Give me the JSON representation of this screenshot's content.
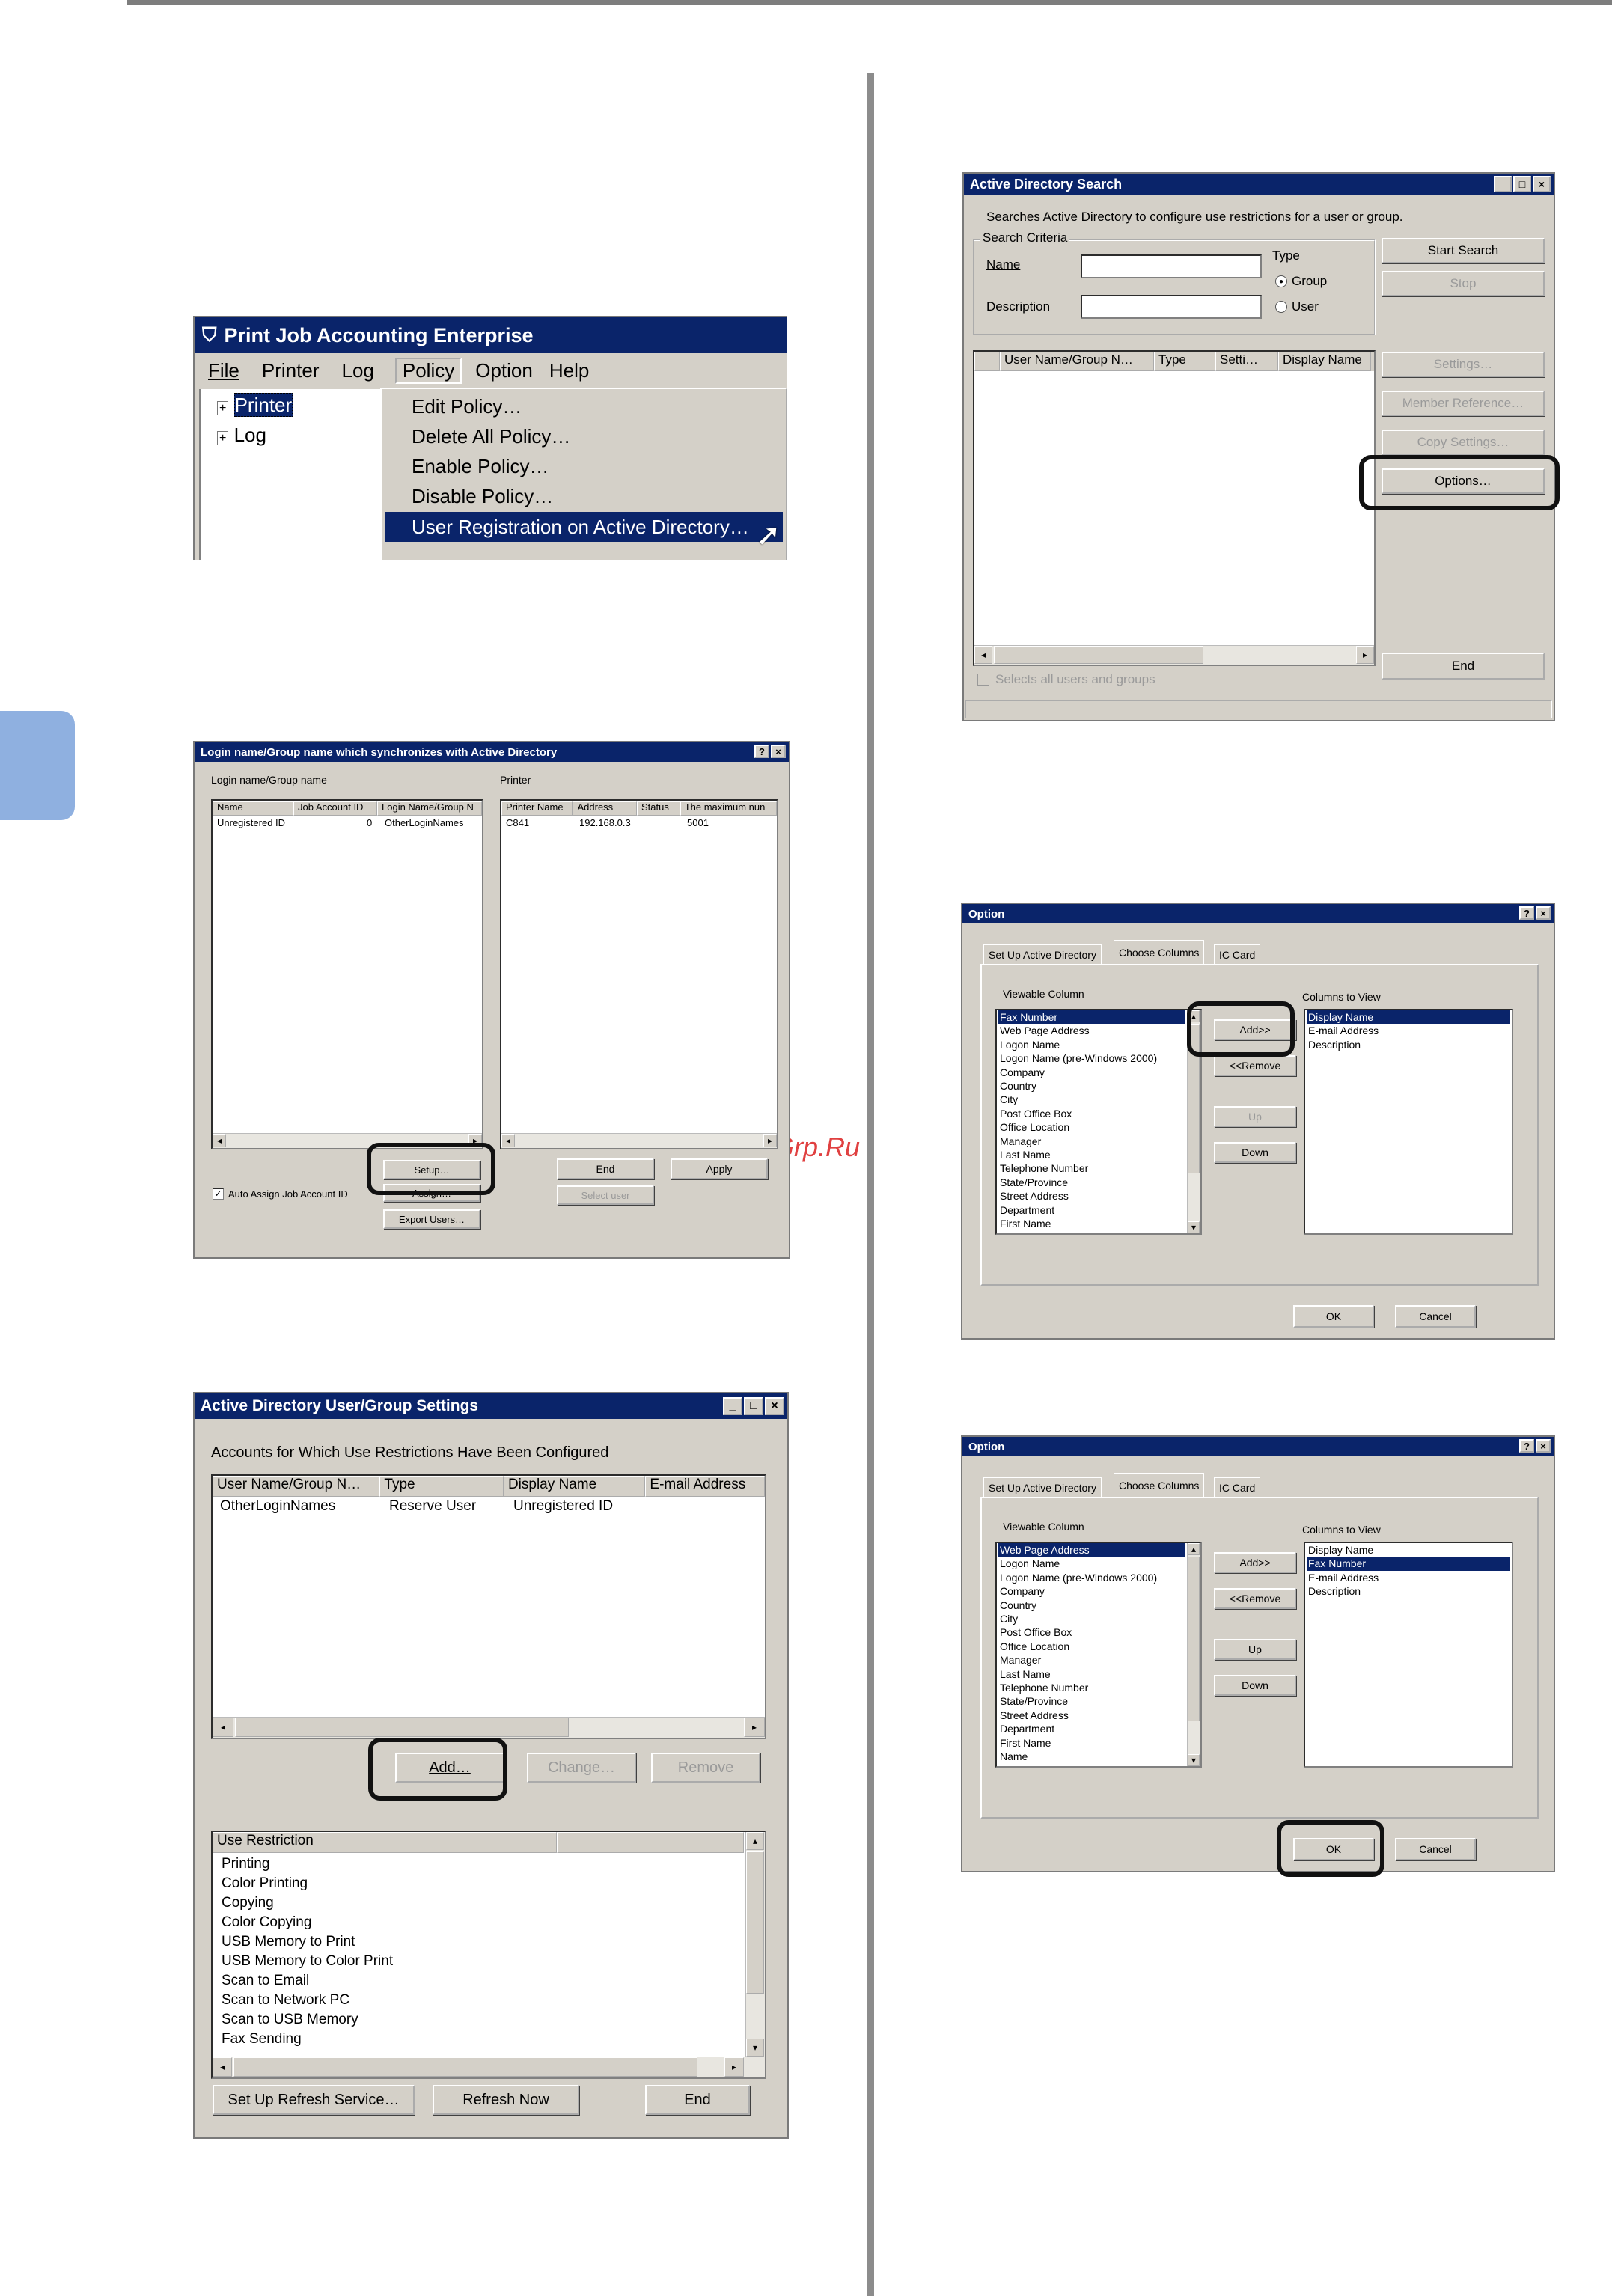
{
  "watermark": "McGrp.Ru",
  "s1": {
    "title": "Print Job Accounting Enterprise",
    "menu": [
      "File",
      "Printer",
      "Log",
      "Policy",
      "Option",
      "Help"
    ],
    "tree": [
      "Printer",
      "Log"
    ],
    "policy_menu": [
      "Edit Policy…",
      "Delete All Policy…",
      "Enable Policy…",
      "Disable Policy…",
      "User Registration on Active Directory…"
    ]
  },
  "s2": {
    "title": "Login name/Group name which synchronizes with Active Directory",
    "left_label": "Login name/Group name",
    "right_label": "Printer",
    "left_cols": [
      "Name",
      "Job Account ID",
      "Login Name/Group N"
    ],
    "left_row": [
      "Unregistered ID",
      "0",
      "OtherLoginNames"
    ],
    "right_cols": [
      "Printer Name",
      "Address",
      "Status",
      "The maximum nun"
    ],
    "right_row": [
      "C841",
      "192.168.0.3",
      "",
      "5001"
    ],
    "setup": "Setup…",
    "assign": "Assign…",
    "export": "Export Users…",
    "end": "End",
    "apply": "Apply",
    "select_user": "Select user",
    "auto_assign": "Auto Assign Job Account ID"
  },
  "s3": {
    "title": "Active Directory User/Group Settings",
    "caption": "Accounts for Which Use Restrictions Have Been Configured",
    "cols": [
      "User Name/Group N…",
      "Type",
      "Display Name",
      "E-mail Address"
    ],
    "row": [
      "OtherLoginNames",
      "Reserve User",
      "Unregistered ID",
      ""
    ],
    "add": "Add…",
    "change": "Change…",
    "remove": "Remove",
    "restriction_header": "Use Restriction",
    "restrictions": [
      "Printing",
      "Color Printing",
      "Copying",
      "Color Copying",
      "USB Memory to Print",
      "USB Memory to Color Print",
      "Scan to Email",
      "Scan to Network PC",
      "Scan to USB Memory",
      "Fax Sending"
    ],
    "setup_refresh": "Set Up Refresh Service…",
    "refresh_now": "Refresh Now",
    "end": "End"
  },
  "s4": {
    "title": "Active Directory Search",
    "desc": "Searches Active Directory to configure use restrictions for a user or group.",
    "criteria": "Search Criteria",
    "name": "Name",
    "description": "Description",
    "type": "Type",
    "group": "Group",
    "user": "User",
    "cols": [
      "User Name/Group N…",
      "Type",
      "Setti…",
      "Display Name"
    ],
    "start": "Start Search",
    "stop": "Stop",
    "settings": "Settings…",
    "member": "Member Reference…",
    "copy": "Copy Settings…",
    "options": "Options…",
    "end": "End",
    "select_all": "Selects all users and groups"
  },
  "s5": {
    "title": "Option",
    "tabs": [
      "Set Up Active Directory",
      "Choose Columns",
      "IC Card"
    ],
    "viewable": "Viewable Column",
    "to_view": "Columns to View",
    "left": [
      "Fax Number",
      "Web Page Address",
      "Logon Name",
      "Logon Name (pre-Windows 2000)",
      "Company",
      "Country",
      "City",
      "Post Office Box",
      "Office Location",
      "Manager",
      "Last Name",
      "Telephone Number",
      "State/Province",
      "Street Address",
      "Department",
      "First Name"
    ],
    "right": [
      "Display Name",
      "E-mail Address",
      "Description"
    ],
    "add": "Add>>",
    "remove": "<<Remove",
    "up": "Up",
    "down": "Down",
    "ok": "OK",
    "cancel": "Cancel"
  },
  "s6": {
    "title": "Option",
    "tabs": [
      "Set Up Active Directory",
      "Choose Columns",
      "IC Card"
    ],
    "viewable": "Viewable Column",
    "to_view": "Columns to View",
    "left": [
      "Web Page Address",
      "Logon Name",
      "Logon Name (pre-Windows 2000)",
      "Company",
      "Country",
      "City",
      "Post Office Box",
      "Office Location",
      "Manager",
      "Last Name",
      "Telephone Number",
      "State/Province",
      "Street Address",
      "Department",
      "First Name",
      "Name"
    ],
    "right": [
      "Display Name",
      "Fax Number",
      "E-mail Address",
      "Description"
    ],
    "add": "Add>>",
    "remove": "<<Remove",
    "up": "Up",
    "down": "Down",
    "ok": "OK",
    "cancel": "Cancel"
  }
}
